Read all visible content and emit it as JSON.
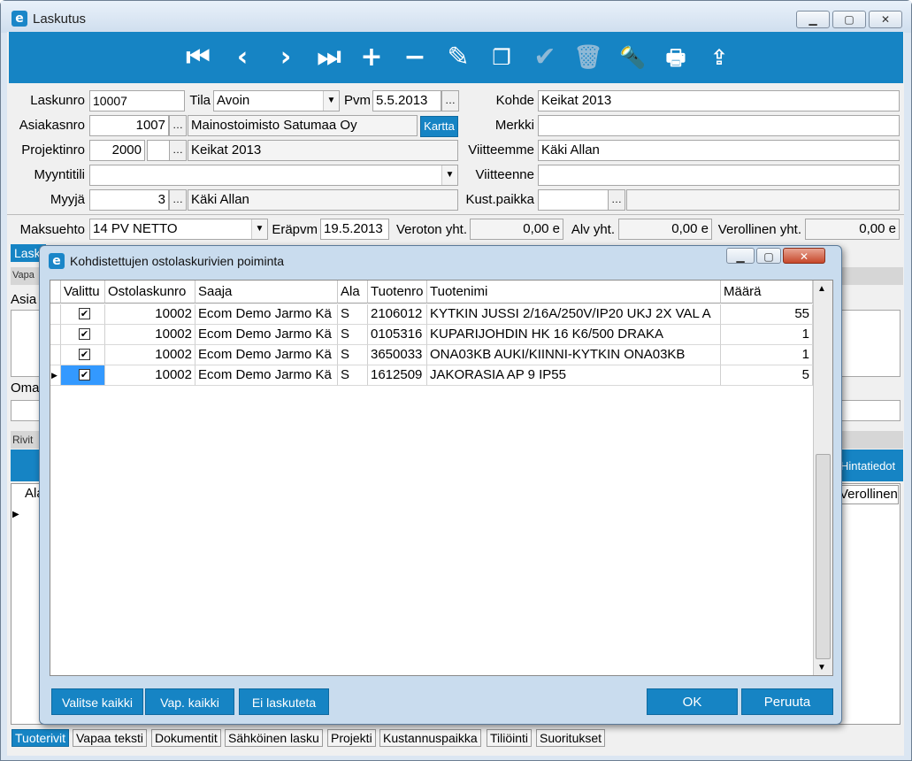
{
  "window": {
    "title": "Laskutus",
    "app_icon": "e"
  },
  "toolbar": {
    "icons": [
      "first-record-icon",
      "previous-record-icon",
      "next-record-icon",
      "last-record-icon",
      "add-icon",
      "remove-icon",
      "edit-icon",
      "copy-icon",
      "confirm-icon",
      "delete-icon",
      "search-icon",
      "print-icon",
      "export-icon"
    ]
  },
  "form": {
    "laskunro_label": "Laskunro",
    "laskunro": "10007",
    "tila_label": "Tila",
    "tila": "Avoin",
    "pvm_label": "Pvm",
    "pvm": "5.5.2013",
    "kohde_label": "Kohde",
    "kohde": "Keikat 2013",
    "asiakasnro_label": "Asiakasnro",
    "asiakasnro": "1007",
    "asiakas_nimi": "Mainostoimisto Satumaa Oy",
    "kartta_label": "Kartta",
    "merkki_label": "Merkki",
    "merkki": "",
    "projektinro_label": "Projektinro",
    "projektinro": "2000",
    "projekti_nimi": "Keikat 2013",
    "viitteemme_label": "Viitteemme",
    "viitteemme": "Käki Allan",
    "myyntitili_label": "Myyntitili",
    "myyntitili": "",
    "viitteenne_label": "Viitteenne",
    "viitteenne": "",
    "myyja_label": "Myyjä",
    "myyja_nro": "3",
    "myyja_nimi": "Käki Allan",
    "kustpaikka_label": "Kust.paikka",
    "kustpaikka": "",
    "maksuehto_label": "Maksuehto",
    "maksuehto": "14 PV NETTO",
    "erapvm_label": "Eräpvm",
    "erapvm": "19.5.2013",
    "veroton_label": "Veroton yht.",
    "veroton": "0,00 e",
    "alv_label": "Alv yht.",
    "alv": "0,00 e",
    "verollinen_label": "Verollinen yht.",
    "verollinen": "0,00 e"
  },
  "background_fragments": {
    "lasku_tab": "Lask",
    "vapaa_tab": "Vapa",
    "asia_label": "Asia",
    "oma_label": "Oma",
    "rivit_label": "Rivit",
    "hintatiedot": "Hintatiedot",
    "ala_col": "Ala",
    "verollinen_col": "Verollinen"
  },
  "dialog": {
    "title": "Kohdistettujen ostolaskurivien poiminta",
    "columns": [
      "Valittu",
      "Ostolaskunro",
      "Saaja",
      "Ala",
      "Tuotenro",
      "Tuotenimi",
      "Määrä"
    ],
    "rows": [
      {
        "valittu": "✔",
        "ostolaskunro": "10002",
        "saaja": "Ecom Demo Jarmo Kä",
        "ala": "S",
        "tuotenro": "2106012",
        "tuotenimi": "KYTKIN JUSSI 2/16A/250V/IP20 UKJ 2X VAL A",
        "maara": "55"
      },
      {
        "valittu": "✔",
        "ostolaskunro": "10002",
        "saaja": "Ecom Demo Jarmo Kä",
        "ala": "S",
        "tuotenro": "0105316",
        "tuotenimi": "KUPARIJOHDIN HK 16 K6/500 DRAKA",
        "maara": "1"
      },
      {
        "valittu": "✔",
        "ostolaskunro": "10002",
        "saaja": "Ecom Demo Jarmo Kä",
        "ala": "S",
        "tuotenro": "3650033",
        "tuotenimi": "ONA03KB AUKI/KIINNI-KYTKIN ONA03KB",
        "maara": "1"
      },
      {
        "valittu": "✔",
        "ostolaskunro": "10002",
        "saaja": "Ecom Demo Jarmo Kä",
        "ala": "S",
        "tuotenro": "1612509",
        "tuotenimi": "JAKORASIA AP 9 IP55",
        "maara": "5"
      }
    ],
    "buttons": {
      "valitse_kaikki": "Valitse kaikki",
      "vap_kaikki": "Vap. kaikki",
      "ei_laskuteta": "Ei laskuteta",
      "ok": "OK",
      "peruuta": "Peruuta"
    }
  },
  "tabs": [
    "Tuoterivit",
    "Vapaa teksti",
    "Dokumentit",
    "Sähköinen lasku",
    "Projekti",
    "Kustannuspaikka",
    "Tiliöinti",
    "Suoritukset"
  ],
  "colors": {
    "accent": "#1684c4",
    "window_bg": "#f0f0f0"
  }
}
